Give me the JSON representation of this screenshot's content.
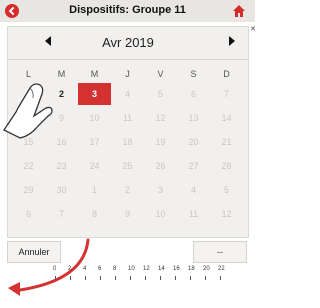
{
  "header": {
    "title": "Dispositifs: Groupe 11"
  },
  "calendar": {
    "month_label": "Avr 2019",
    "weekdays": [
      "L",
      "M",
      "M",
      "J",
      "V",
      "S",
      "D"
    ],
    "rows": [
      [
        "1",
        "2",
        "3",
        "4",
        "5",
        "6",
        "7"
      ],
      [
        "8",
        "9",
        "10",
        "11",
        "12",
        "13",
        "14"
      ],
      [
        "15",
        "16",
        "17",
        "18",
        "19",
        "20",
        "21"
      ],
      [
        "22",
        "23",
        "24",
        "25",
        "26",
        "27",
        "28"
      ],
      [
        "29",
        "30",
        "1",
        "2",
        "3",
        "4",
        "5"
      ],
      [
        "6",
        "7",
        "8",
        "9",
        "10",
        "11",
        "12"
      ]
    ],
    "active_days": [
      "2"
    ],
    "selected_day": "3"
  },
  "footer": {
    "cancel_label": "Annuler",
    "right_label": "--"
  },
  "timeline": {
    "ticks": [
      "0",
      "2",
      "4",
      "6",
      "8",
      "10",
      "12",
      "14",
      "16",
      "18",
      "20",
      "22"
    ]
  },
  "colors": {
    "accent": "#d43131",
    "header_bg": "#e8e6e3",
    "calendar_bg": "#f1f0ee"
  }
}
